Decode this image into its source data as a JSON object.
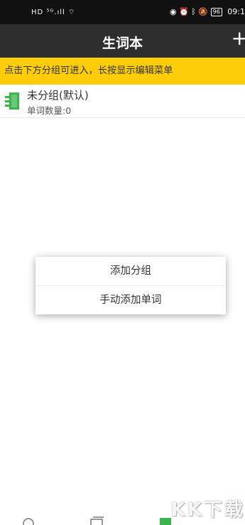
{
  "status_bar": {
    "left_text": "HD ⁵ᴳ.ıll ⌔",
    "battery": "96",
    "time": "09:1"
  },
  "header": {
    "title": "生词本",
    "add_label": "+"
  },
  "hint_banner": {
    "text": "点击下方分组可进入，长按显示编辑菜单"
  },
  "groups": [
    {
      "name": "未分组(默认)",
      "count_label": "单词数量:0"
    }
  ],
  "context_menu": {
    "items": [
      "添加分组",
      "手动添加单词"
    ]
  },
  "watermark": "KK下载",
  "colors": {
    "header_bg": "#2e2e2e",
    "banner_bg": "#fccd08",
    "group_icon": "#3ab54a"
  }
}
